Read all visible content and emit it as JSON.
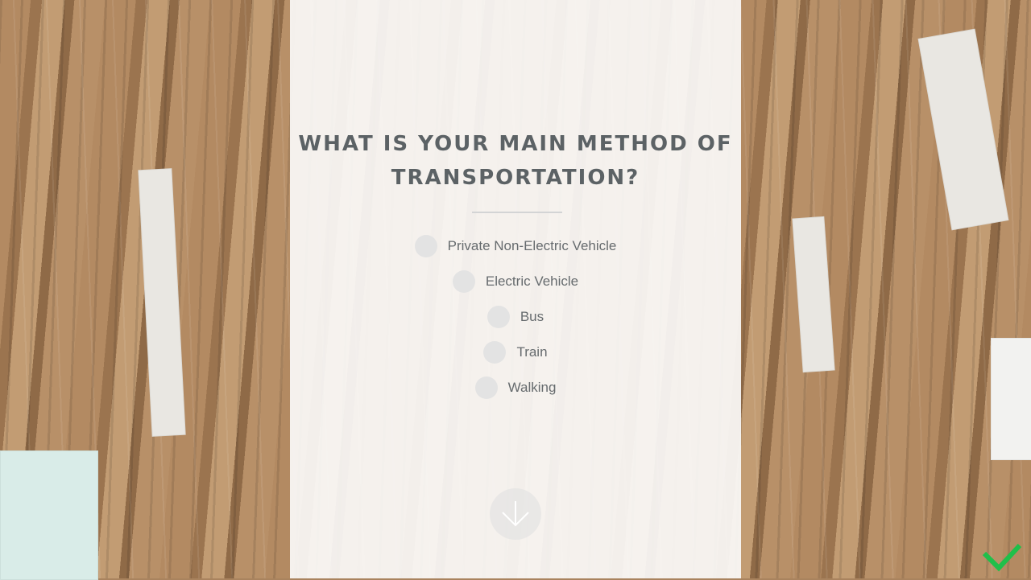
{
  "survey": {
    "question": "WHAT IS YOUR MAIN METHOD OF TRANSPORTATION?",
    "options": [
      {
        "label": "Private Non-Electric Vehicle"
      },
      {
        "label": "Electric Vehicle"
      },
      {
        "label": "Bus"
      },
      {
        "label": "Train"
      },
      {
        "label": "Walking"
      }
    ],
    "next_icon": "arrow-down-icon"
  },
  "colors": {
    "question_text": "#5c6265",
    "option_text": "#666b6e",
    "radio_fill": "#e3e3e3",
    "panel": "#faf9f8",
    "accent_green": "#1fbf4a"
  }
}
